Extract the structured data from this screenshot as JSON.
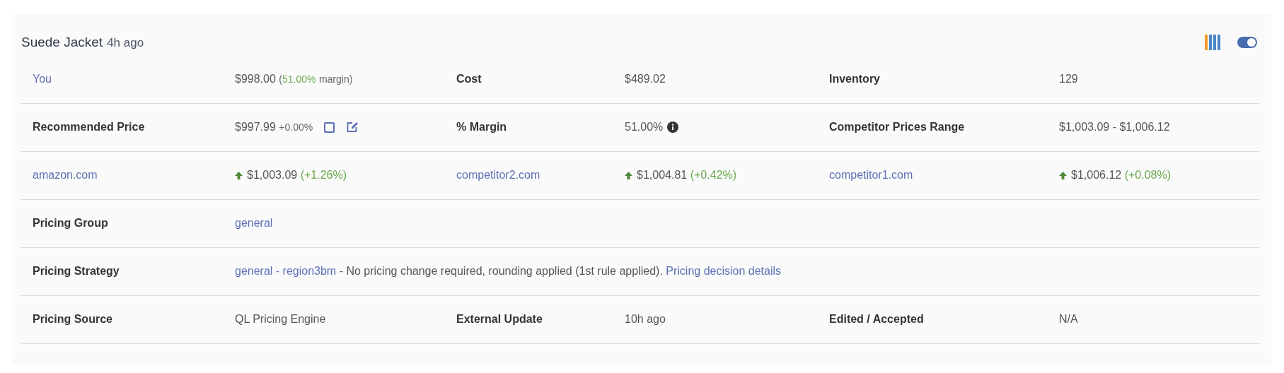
{
  "header": {
    "title": "Suede Jacket",
    "time": "4h ago",
    "toggle": {
      "on": true
    }
  },
  "rows": [
    {
      "cells": [
        {
          "kind": "link",
          "text": "You"
        },
        {
          "kind": "value",
          "parts": [
            {
              "text": "$998.00",
              "kind": "plain"
            },
            {
              "text": "(",
              "kind": "small"
            },
            {
              "text": "51.00%",
              "kind": "green-small"
            },
            {
              "text": "margin)",
              "kind": "small"
            }
          ]
        },
        {
          "kind": "label",
          "text": "Cost"
        },
        {
          "kind": "value",
          "parts": [
            {
              "text": "$489.02",
              "kind": "plain"
            }
          ]
        },
        {
          "kind": "label",
          "text": "Inventory"
        },
        {
          "kind": "value",
          "parts": [
            {
              "text": "129",
              "kind": "plain"
            }
          ]
        }
      ]
    },
    {
      "cells": [
        {
          "kind": "label",
          "text": "Recommended Price"
        },
        {
          "kind": "value",
          "parts": [
            {
              "text": "$997.99",
              "kind": "plain"
            },
            {
              "text": "+0.00%",
              "kind": "small"
            }
          ],
          "icons": [
            {
              "kind": "checkbox",
              "checked": false
            },
            {
              "kind": "edit"
            }
          ]
        },
        {
          "kind": "label",
          "text": "% Margin"
        },
        {
          "kind": "value",
          "parts": [
            {
              "text": "51.00%",
              "kind": "plain"
            }
          ],
          "icons": [
            {
              "kind": "info"
            }
          ]
        },
        {
          "kind": "label",
          "text": "Competitor Prices Range"
        },
        {
          "kind": "value",
          "parts": [
            {
              "text": "$1,003.09 - $1,006.12",
              "kind": "plain"
            }
          ]
        }
      ]
    },
    {
      "cells": [
        {
          "kind": "link",
          "text": "amazon.com"
        },
        {
          "kind": "rise",
          "parts": [
            {
              "text": "$1,003.09",
              "kind": "plain"
            },
            {
              "text": "(+1.26%)",
              "kind": "green"
            }
          ]
        },
        {
          "kind": "link",
          "text": "competitor2.com"
        },
        {
          "kind": "rise",
          "parts": [
            {
              "text": "$1,004.81",
              "kind": "plain"
            },
            {
              "text": "(+0.42%)",
              "kind": "green"
            }
          ]
        },
        {
          "kind": "link",
          "text": "competitor1.com"
        },
        {
          "kind": "rise",
          "parts": [
            {
              "text": "$1,006.12",
              "kind": "plain"
            },
            {
              "text": "(+0.08%)",
              "kind": "green"
            }
          ]
        }
      ]
    },
    {
      "cells": [
        {
          "kind": "label",
          "text": "Pricing Group"
        },
        {
          "kind": "link",
          "text": "general"
        }
      ]
    },
    {
      "cells": [
        {
          "kind": "label",
          "text": "Pricing Strategy"
        },
        {
          "kind": "sentence",
          "parts": [
            {
              "text": "general - region3bm",
              "kind": "link"
            },
            {
              "text": "- No pricing change required, rounding applied (1st rule applied).",
              "kind": "plain"
            },
            {
              "text": "Pricing decision details",
              "kind": "link"
            }
          ]
        }
      ]
    },
    {
      "cells": [
        {
          "kind": "label",
          "text": "Pricing Source"
        },
        {
          "kind": "value",
          "parts": [
            {
              "text": "QL Pricing Engine",
              "kind": "plain"
            }
          ]
        },
        {
          "kind": "label",
          "text": "External Update"
        },
        {
          "kind": "value",
          "parts": [
            {
              "text": "10h ago",
              "kind": "plain"
            }
          ]
        },
        {
          "kind": "label",
          "text": "Edited / Accepted"
        },
        {
          "kind": "value",
          "parts": [
            {
              "text": "N/A",
              "kind": "plain"
            }
          ]
        }
      ]
    }
  ]
}
